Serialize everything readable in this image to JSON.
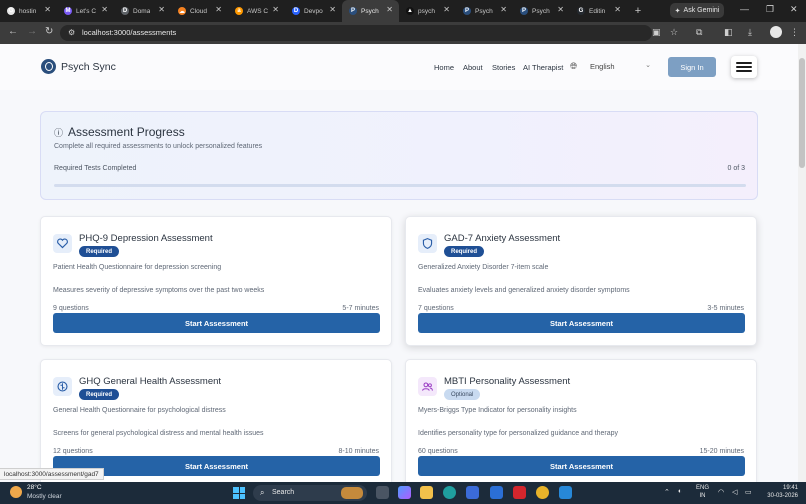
{
  "browser": {
    "tabs": [
      {
        "label": "hostin",
        "color": "#e8e8e8",
        "glyph": "G"
      },
      {
        "label": "Let's C",
        "color": "#7a5af5",
        "glyph": "M"
      },
      {
        "label": "Doma",
        "color": "#5f6368",
        "glyph": "D"
      },
      {
        "label": "Cloud",
        "color": "#f48120",
        "glyph": "☁"
      },
      {
        "label": "AWS C",
        "color": "#ff9900",
        "glyph": "a"
      },
      {
        "label": "Devpo",
        "color": "#2962ff",
        "glyph": "D"
      },
      {
        "label": "Psych",
        "color": "#2a4e7c",
        "glyph": "P",
        "active": true
      },
      {
        "label": "psych",
        "color": "#111111",
        "glyph": "▲"
      },
      {
        "label": "Psych",
        "color": "#2a4e7c",
        "glyph": "P"
      },
      {
        "label": "Psych",
        "color": "#2a4e7c",
        "glyph": "P"
      },
      {
        "label": "Editin",
        "color": "#24292f",
        "glyph": "G"
      }
    ],
    "new_tab_glyph": "+",
    "ask_gemini": "Ask Gemini",
    "url": "localhost:3000/assessments",
    "status_url": "localhost:3000/assessment/gad7"
  },
  "site": {
    "brand": "Psych Sync",
    "nav": [
      "Home",
      "About",
      "Stories",
      "AI Therapist"
    ],
    "language": "English",
    "sign_in": "Sign In"
  },
  "progress": {
    "title": "Assessment Progress",
    "subtitle": "Complete all required assessments to unlock personalized features",
    "label": "Required Tests Completed",
    "count": "0 of 3",
    "completed": 0,
    "total": 3
  },
  "assessments": [
    {
      "title": "PHQ-9 Depression Assessment",
      "badge": "Required",
      "description": "Patient Health Questionnaire for depression screening",
      "detail": "Measures severity of depressive symptoms over the past two weeks",
      "questions": "9 questions",
      "time": "5-7 minutes",
      "button": "Start Assessment",
      "icon": "heart-icon",
      "icon_color": "#2a5ea8",
      "icon_bg": "#e6eefa"
    },
    {
      "title": "GAD-7 Anxiety Assessment",
      "badge": "Required",
      "description": "Generalized Anxiety Disorder 7-item scale",
      "detail": "Evaluates anxiety levels and generalized anxiety disorder symptoms",
      "questions": "7 questions",
      "time": "3-5 minutes",
      "button": "Start Assessment",
      "icon": "shield-icon",
      "icon_color": "#2a5ea8",
      "icon_bg": "#e6eefa"
    },
    {
      "title": "GHQ General Health Assessment",
      "badge": "Required",
      "description": "General Health Questionnaire for psychological distress",
      "detail": "Screens for general psychological distress and mental health issues",
      "questions": "12 questions",
      "time": "8-10 minutes",
      "button": "Start Assessment",
      "icon": "brain-icon",
      "icon_color": "#2a5ea8",
      "icon_bg": "#e6eefa"
    },
    {
      "title": "MBTI Personality Assessment",
      "badge": "Optional",
      "description": "Myers-Briggs Type Indicator for personality insights",
      "detail": "Identifies personality type for personalized guidance and therapy",
      "questions": "60 questions",
      "time": "15-20 minutes",
      "button": "Start Assessment",
      "icon": "users-icon",
      "icon_color": "#9b3fc4",
      "icon_bg": "#f4e8fb"
    }
  ],
  "taskbar": {
    "temp": "28°C",
    "condition": "Mostly clear",
    "search": "Search",
    "lang_top": "ENG",
    "lang_bottom": "IN",
    "time": "19:41",
    "date": "30-03-2026"
  },
  "colors": {
    "primary": "#2563a7",
    "required_badge": "#1f4f95",
    "optional_badge": "#c8daf0",
    "sign_in": "#7d9fc3"
  }
}
